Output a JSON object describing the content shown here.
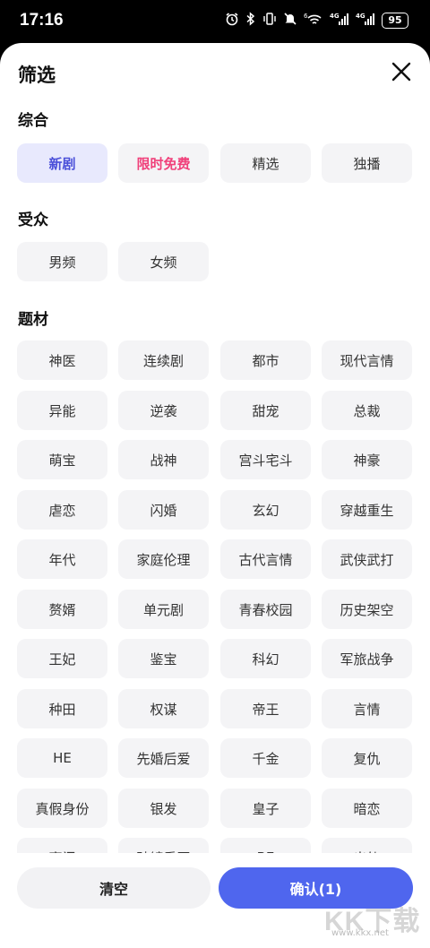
{
  "status_bar": {
    "time": "17:16",
    "icons": [
      "alarm-icon",
      "bluetooth-icon",
      "vibrate-icon",
      "mute-icon",
      "wifi-icon",
      "signal-4g-icon",
      "signal-4g-icon"
    ],
    "wifi_label": "6",
    "signal1_label": "4G",
    "signal2_label": "4G",
    "battery": "95"
  },
  "sheet": {
    "title": "筛选"
  },
  "sections": {
    "general": {
      "title": "综合",
      "options": [
        "新剧",
        "限时免费",
        "精选",
        "独播"
      ],
      "selected": "新剧"
    },
    "audience": {
      "title": "受众",
      "options": [
        "男频",
        "女频"
      ]
    },
    "genre": {
      "title": "题材",
      "options": [
        "神医",
        "连续剧",
        "都市",
        "现代言情",
        "异能",
        "逆袭",
        "甜宠",
        "总裁",
        "萌宝",
        "战神",
        "宫斗宅斗",
        "神豪",
        "虐恋",
        "闪婚",
        "玄幻",
        "穿越重生",
        "年代",
        "家庭伦理",
        "古代言情",
        "武侠武打",
        "赘婿",
        "单元剧",
        "青春校园",
        "历史架空",
        "王妃",
        "鉴宝",
        "科幻",
        "军旅战争",
        "种田",
        "权谋",
        "帝王",
        "言情",
        "HE",
        "先婚后爱",
        "千金",
        "复仇",
        "真假身份",
        "银发",
        "皇子",
        "暗恋",
        "豪门",
        "破镜重圆",
        "BE",
        "出轨"
      ]
    }
  },
  "footer": {
    "clear_label": "清空",
    "confirm_label": "确认(1)"
  },
  "watermark": {
    "logo": "KK下载",
    "url": "www.kkx.net"
  },
  "colors": {
    "accent": "#4f66ee",
    "selected_chip_bg": "#e8e9fd",
    "selected_chip_text": "#4a4fd9",
    "promo_text": "#f0407a",
    "chip_bg": "#f4f4f6"
  }
}
